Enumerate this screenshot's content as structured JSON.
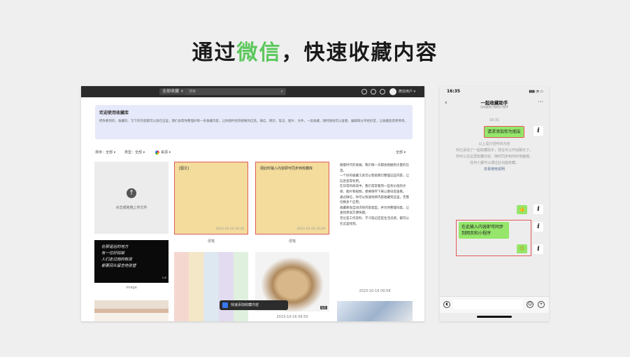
{
  "headline": {
    "before": "通过",
    "highlight": "微信",
    "after": "，快速收藏内容"
  },
  "app": {
    "tab_label": "全部收藏 ×",
    "search_placeholder": "搜索",
    "search_icon": "⌕",
    "user_name": "微信用户 ▾",
    "banner": {
      "title": "欢迎使用收藏库",
      "body": "把你看到的、收藏的、写下的内容都可以放在这里，我们会帮你整理好每一条收藏内容，让你随时找到想要的信息。微信、网页、笔记、图片、文件，一处收藏，随时随地可以查看、编辑和分享给好友，让收藏变得更简单。"
    },
    "filters": {
      "sort": "排序：全部 ▾",
      "type": "类型：全部 ▾",
      "source": "来源 ▾",
      "count": "全部 ▾"
    },
    "upload_card": {
      "icon": "↑",
      "label": "点击或拖拽上传文件"
    },
    "notes": [
      {
        "title": "[图文]",
        "date": "2023-10-16 10:30",
        "caption": "便笺"
      },
      {
        "title": "把此时输入内容即可同步到收藏库",
        "date": "2023-10-16 10:29",
        "caption": "便笺"
      }
    ],
    "article": {
      "paragraphs": [
        "随着时代的发展，我们每一天都会接触到大量的信息。",
        "一个好的收藏工具可以帮助我们整理这些内容，让信息变得有用。",
        "在日常的阅读中，我们常常看到一些有价值的文章、图片和视频，想要保存下来以便日后查看。",
        "通过微信，你可以快速地将内容收藏到这里，无需切换多个应用。",
        "收藏库会自动识别内容类型，并为你整理归类，让查找更加方便快捷。",
        "无论是工作资料、学习笔记还是生活灵感，都可以在这里找到。"
      ],
      "date": "2023-10-16 09:58"
    },
    "handwriting": {
      "lines": [
        "在那遥远的地方",
        "有一位好姑娘",
        "人们走过她的帐房",
        "都要回头留恋地张望"
      ],
      "count": "1/4",
      "caption": "image"
    },
    "food_badge": "1/2",
    "food_date": "2023-10-16 09:50",
    "toast_text": "快速添加收藏内容"
  },
  "phone": {
    "time": "16:35",
    "signal": "▮▮▮ ◔ ▭",
    "back": "‹",
    "title": "一起收藏助手",
    "subtitle": "点击此处可使用小程序",
    "more": "···",
    "msg_time": "16:31",
    "bubble1": "请求添加你为朋友",
    "sys_lines": [
      "以上是打招呼的内容",
      "你已添加了一起收藏助手，现在可以开始聊天了。",
      "你可以在这里收藏内容，随时同步到你的电脑端。",
      "任何人都可以通过此功能收藏，"
    ],
    "sys_link": "去看使用说明",
    "bubble2": "在此输入内容即可同步到网页和小程序",
    "emoji": "👍",
    "emoji2": "☺",
    "avatar": "i"
  }
}
